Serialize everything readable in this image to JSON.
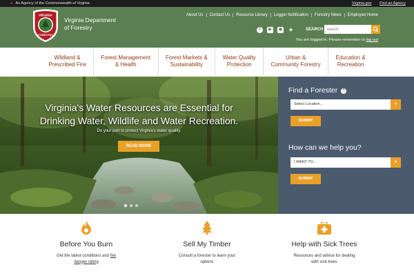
{
  "agency_bar": {
    "left_text": "An Agency of the Commonwealth of Virginia",
    "links": [
      "Virginia.gov",
      "Find an Agency"
    ]
  },
  "header": {
    "logo_line1": "Virginia Department",
    "logo_line2": "of Forestry",
    "shield_top": "VIRGINIA",
    "shield_bottom": "FORESTRY",
    "util_links": [
      "About Us",
      "Contact Us",
      "Resource Library",
      "Logger Notification",
      "Forestry News",
      "Employee Home"
    ],
    "social_icons": [
      "facebook-icon",
      "youtube-icon",
      "instagram-icon",
      "twitter-icon"
    ],
    "search_label": "SEARCH",
    "search_placeholder": "search",
    "login_text": "You are logged in. Please remember to",
    "logout_label": "log out"
  },
  "nav": [
    {
      "line1": "Wildland &",
      "line2": "Prescribed Fire"
    },
    {
      "line1": "Forest Management",
      "line2": "& Health"
    },
    {
      "line1": "Forest Markets &",
      "line2": "Sustainability"
    },
    {
      "line1": "Water Quality",
      "line2": "Protection"
    },
    {
      "line1": "Urban &",
      "line2": "Community Forestry"
    },
    {
      "line1": "Education &",
      "line2": "Recreation"
    }
  ],
  "hero": {
    "title_line1": "Virginia's Water Resources are Essential for",
    "title_line2": "Drinking Water, Wildlife and Water Recreation.",
    "subtitle": "Do your part to protect Virginia's water quality.",
    "button": "READ MORE"
  },
  "side": {
    "forester_title": "Find a Forester",
    "location_select": "Select Location...",
    "submit1": "SUBMIT",
    "help_title": "How can we help you?",
    "want_select": "I WANT TO...",
    "submit2": "SUBMIT"
  },
  "cards": [
    {
      "icon": "flame-icon",
      "title": "Before You Burn",
      "text1": "Get the latest conditions and",
      "link": "fire",
      "text2": "danger rating"
    },
    {
      "icon": "tree-icon",
      "title": "Sell My Timber",
      "text1": "Consult a forester to learn your",
      "link": "",
      "text2": "options"
    },
    {
      "icon": "first-aid-kit-icon",
      "title": "Help with Sick Trees",
      "text1": "Resources and advice for dealing",
      "link": "",
      "text2": "with sick trees"
    }
  ],
  "colors": {
    "header_green": "#5b7f52",
    "accent_orange": "#e8a028",
    "nav_text": "#8a3b12",
    "panel_slate": "#4b5a6d"
  }
}
